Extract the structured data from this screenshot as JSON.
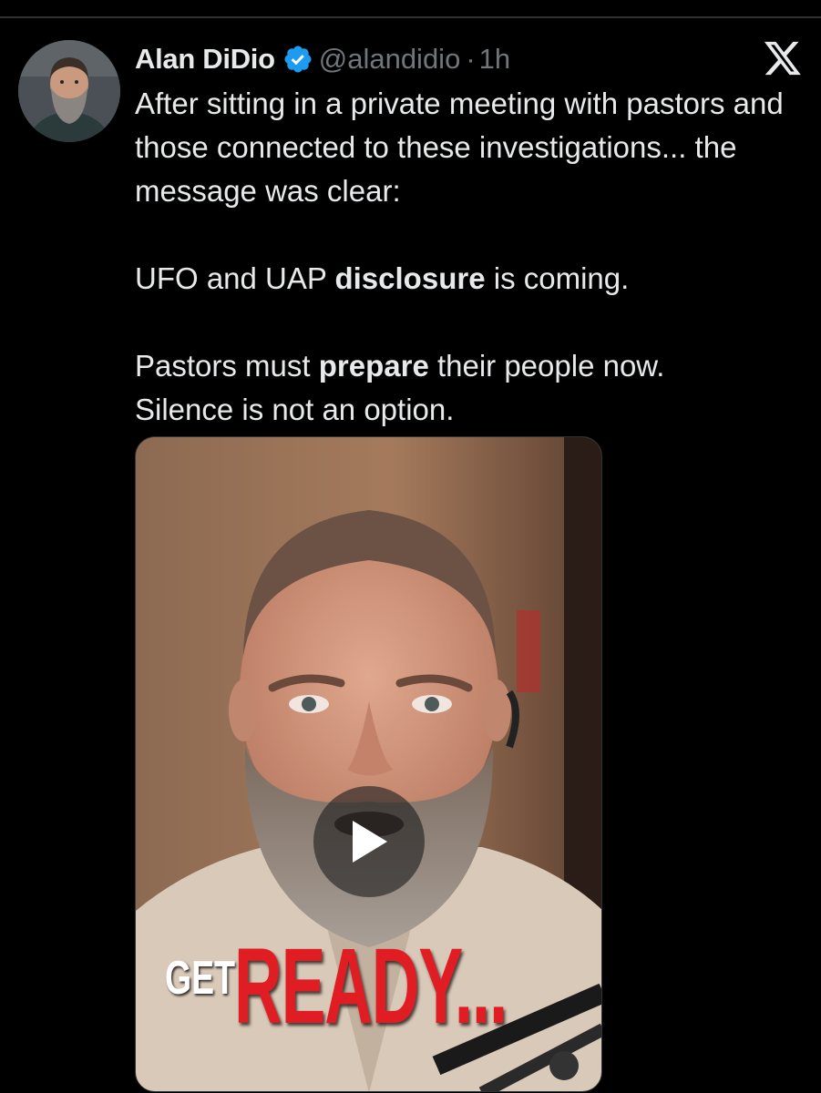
{
  "tweet": {
    "author": {
      "display_name": "Alan DiDio",
      "handle": "@alandidio",
      "separator": "·",
      "time": "1h",
      "verified": true
    },
    "text": {
      "line1": "After sitting in a private meeting with pastors and those connected to these investigations... the message was clear:",
      "p2_before": "UFO and UAP ",
      "p2_bold": "disclosure",
      "p2_after": " is coming.",
      "p3_before": "Pastors must ",
      "p3_bold": "prepare",
      "p3_after": " their people now.",
      "p3_line2": "Silence is not an option."
    },
    "media": {
      "type": "video",
      "caption_get": "GET",
      "caption_ready": "READY..."
    },
    "colors": {
      "background": "#000000",
      "text": "#e7e9ea",
      "secondary": "#71767b",
      "verified": "#1d9bf0",
      "caption_red": "#e11d24"
    },
    "icons": {
      "close": "x-logo-icon",
      "verified": "verified-badge-icon",
      "play": "play-icon"
    }
  }
}
